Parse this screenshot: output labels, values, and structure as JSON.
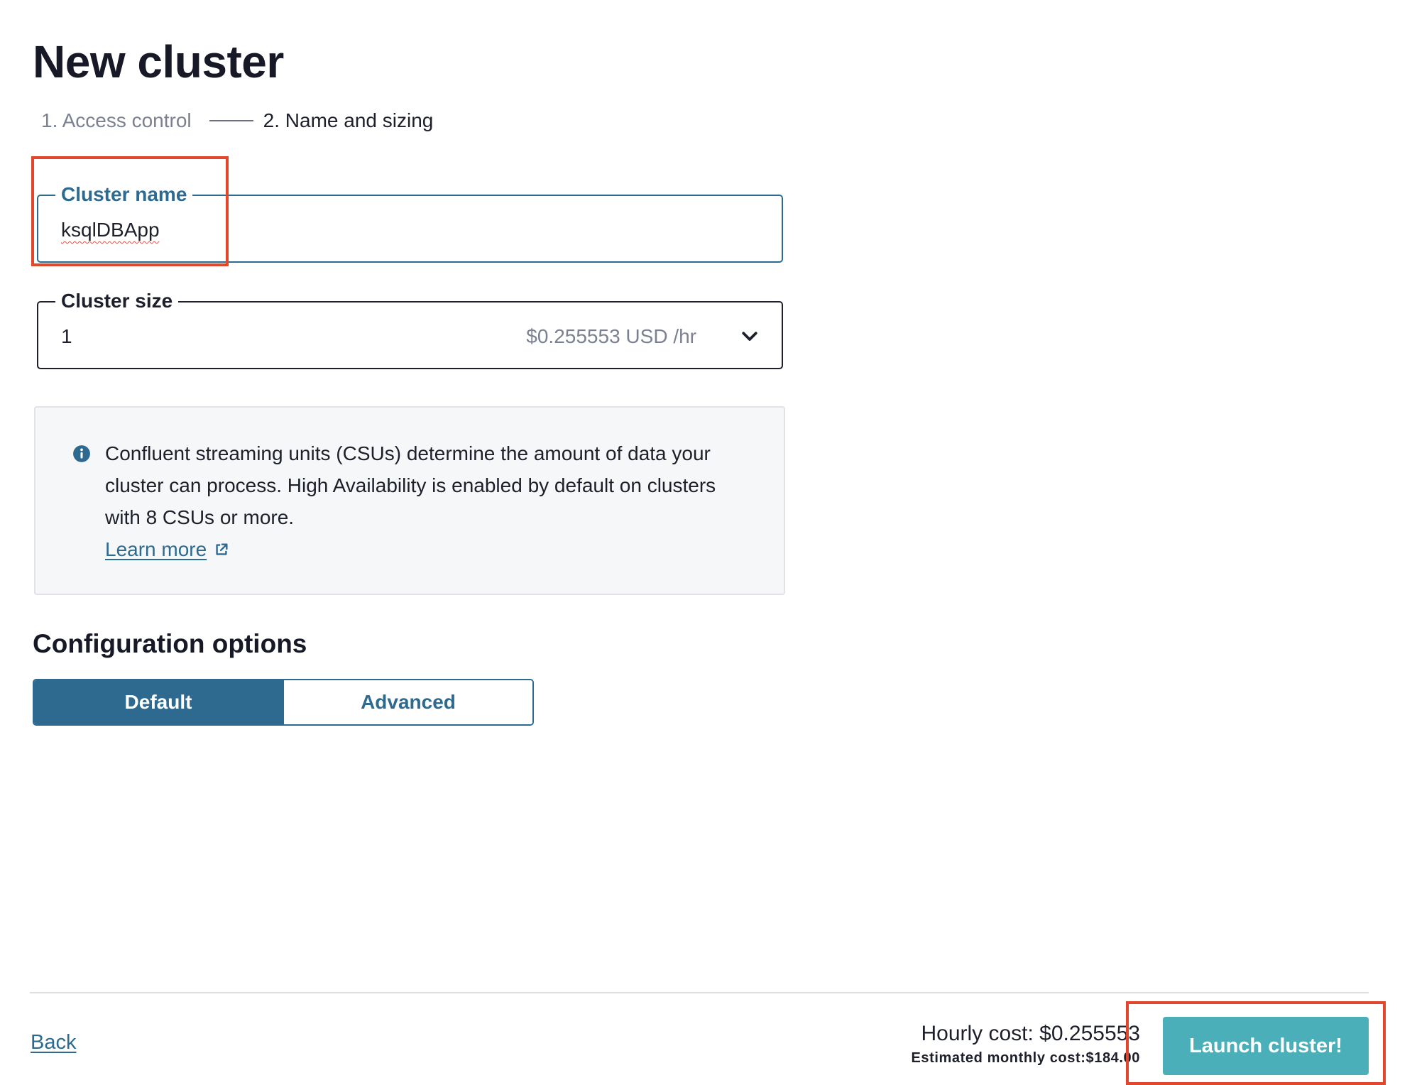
{
  "page": {
    "title": "New cluster"
  },
  "stepper": {
    "step1": "1. Access control",
    "step2": "2. Name and sizing"
  },
  "cluster_name": {
    "label": "Cluster name",
    "value": "ksqlDBApp"
  },
  "cluster_size": {
    "label": "Cluster size",
    "value": "1",
    "price": "$0.255553 USD /hr"
  },
  "info": {
    "text": "Confluent streaming units (CSUs) determine the amount of data your cluster can process. High Availability is enabled by default on clusters with 8 CSUs or more.",
    "link": "Learn more"
  },
  "config": {
    "title": "Configuration options",
    "options": [
      "Default",
      "Advanced"
    ],
    "selected": "Default"
  },
  "footer": {
    "back": "Back",
    "hourly_cost": "Hourly cost: $0.255553",
    "monthly_cost": "Estimated monthly cost:$184.00",
    "launch": "Launch cluster!"
  },
  "colors": {
    "primary": "#2e6a90",
    "launch": "#4aafb9",
    "highlight": "#e2472e"
  },
  "icons": [
    "info-icon",
    "chevron-down-icon",
    "external-link-icon"
  ]
}
